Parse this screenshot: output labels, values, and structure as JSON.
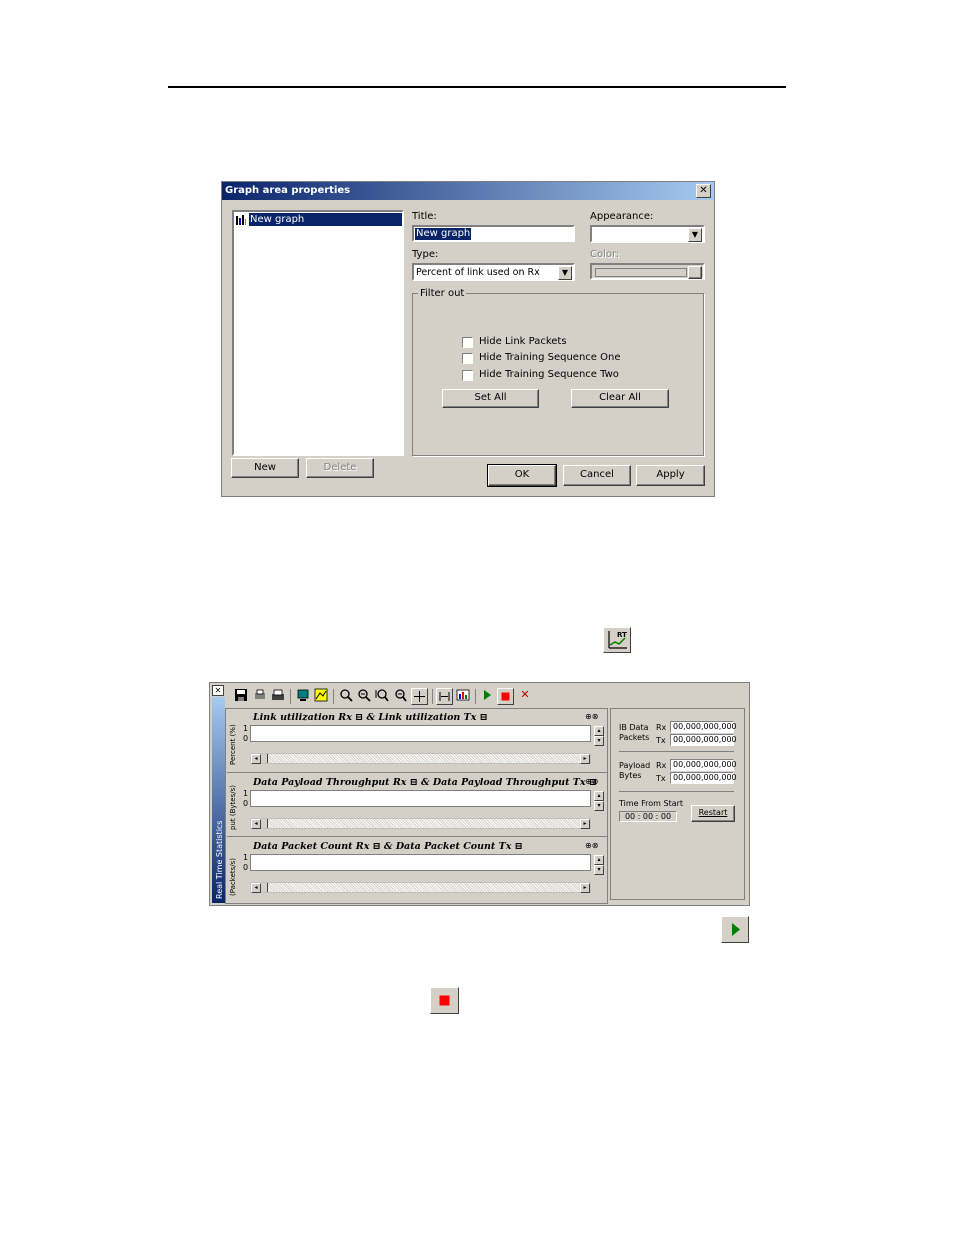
{
  "dialog": {
    "title": "Graph area properties",
    "close_glyph": "✕",
    "tree_item": "New graph",
    "title_label": "Title:",
    "title_value": "New graph",
    "type_label": "Type:",
    "type_value": "Percent of link used on Rx",
    "appearance_label": "Appearance:",
    "appearance_value": "",
    "color_label": "Color:",
    "filter_label": "Filter out",
    "checkboxes": [
      "Hide Link Packets",
      "Hide Training Sequence One",
      "Hide Training Sequence Two"
    ],
    "set_all": "Set All",
    "clear_all": "Clear All",
    "new_btn": "New",
    "delete_btn": "Delete",
    "ok_btn": "OK",
    "cancel_btn": "Cancel",
    "apply_btn": "Apply"
  },
  "icons": {
    "graph_icon": "graph-icon",
    "play_icon": "play-icon",
    "stop_icon": "stop-icon"
  },
  "rts": {
    "side_title": "Real Time Statistics",
    "close_glyph": "✕",
    "graphs": [
      {
        "title": "Link utilization Rx ⊟ & Link utilization Tx ⊟",
        "ylabel": "Percent (%)",
        "ymax": "1",
        "ymin": "0"
      },
      {
        "title": "Data Payload Throughput Rx ⊟ & Data Payload Throughput Tx ⊟",
        "ylabel": "put (Bytes/s)",
        "ymax": "1",
        "ymin": "0"
      },
      {
        "title": "Data Packet Count Rx ⊟ & Data Packet Count Tx ⊟",
        "ylabel": "(Packets/s)",
        "ymax": "1",
        "ymin": "0"
      }
    ],
    "ib_label_1": "IB Data",
    "ib_label_2": "Packets",
    "payload_label_1": "Payload",
    "payload_label_2": "Bytes",
    "rx": "Rx",
    "tx": "Tx",
    "ib_rx": "00,000,000,000",
    "ib_tx": "00,000,000,000",
    "pl_rx": "00,000,000,000",
    "pl_tx": "00,000,000,000",
    "time_label": "Time From Start",
    "time_value": "00 : 00 : 00",
    "restart": "Restart"
  }
}
